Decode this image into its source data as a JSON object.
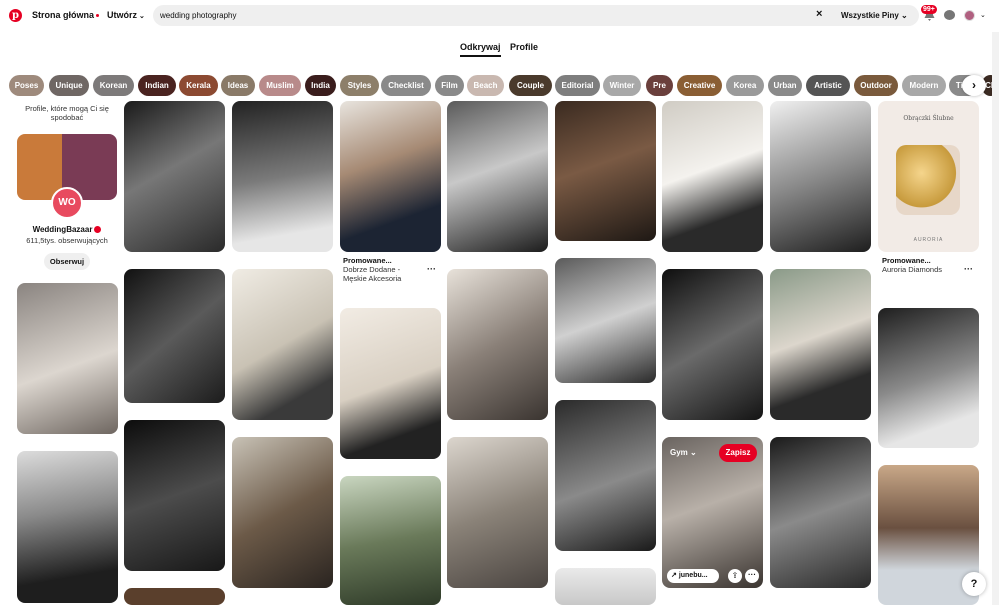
{
  "header": {
    "home_label": "Strona główna",
    "create_label": "Utwórz",
    "search_value": "wedding photography",
    "filter_label": "Wszystkie Piny",
    "notifications_badge": "99+"
  },
  "tabs": [
    {
      "label": "Odkrywaj",
      "active": true
    },
    {
      "label": "Profile",
      "active": false
    }
  ],
  "chips": [
    {
      "label": "Poses",
      "color": "#9e8a7c"
    },
    {
      "label": "Unique",
      "color": "#6f6764"
    },
    {
      "label": "Korean",
      "color": "#7d7a7a"
    },
    {
      "label": "Indian",
      "color": "#4a2320"
    },
    {
      "label": "Kerala",
      "color": "#8c4a32"
    },
    {
      "label": "Ideas",
      "color": "#8a7a68"
    },
    {
      "label": "Muslim",
      "color": "#b88a8a"
    },
    {
      "label": "India",
      "color": "#3a1d1c"
    },
    {
      "label": "Styles",
      "color": "#8d7f6a"
    },
    {
      "label": "Checklist",
      "color": "#8a8a8a"
    },
    {
      "label": "Film",
      "color": "#8a8a8a"
    },
    {
      "label": "Beach",
      "color": "#c9b8b0"
    },
    {
      "label": "Couple",
      "color": "#4a3a2c"
    },
    {
      "label": "Editorial",
      "color": "#7e7e7e"
    },
    {
      "label": "Winter",
      "color": "#a8a8a8"
    },
    {
      "label": "Pre",
      "color": "#6a3f3c"
    },
    {
      "label": "Creative",
      "color": "#8a5e34"
    },
    {
      "label": "Korea",
      "color": "#9a9a9a"
    },
    {
      "label": "Urban",
      "color": "#8a8a8a"
    },
    {
      "label": "Artistic",
      "color": "#555555"
    },
    {
      "label": "Outdoor",
      "color": "#7a5a3c"
    },
    {
      "label": "Modern",
      "color": "#a8a8a8"
    },
    {
      "label": "Tips",
      "color": "#8a8a8a"
    },
    {
      "label": "Ch",
      "color": "#3a2a22"
    }
  ],
  "profile_card": {
    "header": "Profile, które mogą Ci się spodobać",
    "logo_text": "WO",
    "name": "WeddingBazaar",
    "followers": "611,5tys. obserwujących",
    "follow_label": "Obserwuj"
  },
  "promoted": [
    {
      "label": "Promowane...",
      "source": "Dobrze Dodane - Męskie Akcesoria"
    },
    {
      "label": "Promowane...",
      "source": "Auroria Diamonds"
    }
  ],
  "hover_pin": {
    "board": "Gym",
    "save_label": "Zapisz",
    "link_label": "junebu..."
  },
  "ad_text": {
    "line1": "Obrączki Ślubne",
    "brand": "AURORIA"
  },
  "help_label": "?"
}
